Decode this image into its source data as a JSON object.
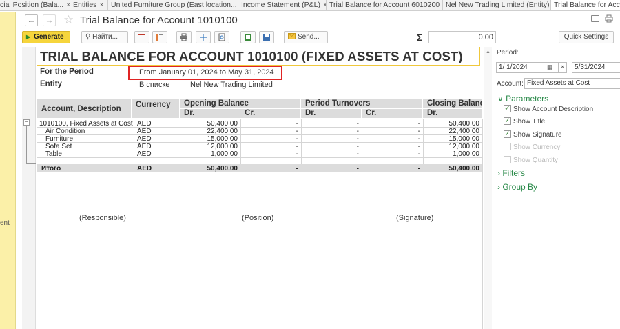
{
  "tabs": [
    {
      "label": "cial Position (Bala..."
    },
    {
      "label": "Entities"
    },
    {
      "label": "United Furniture Group (East location..."
    },
    {
      "label": "Income Statement (P&L)"
    },
    {
      "label": "Trial Balance for Account 6010200"
    },
    {
      "label": "Nel New Trading Limited (Entity)"
    },
    {
      "label": "Trial Balance for Acco"
    }
  ],
  "tab_close": "×",
  "left_strip_text": "ent",
  "nav": {
    "back": "←",
    "forward": "→",
    "star": "☆"
  },
  "window_title": "Trial Balance for Account 1010100",
  "toolbar": {
    "generate": "Generate",
    "find": "Найти...",
    "send": "Send...",
    "sigma": "Σ",
    "sum_value": "0.00",
    "quick_settings": "Quick Settings"
  },
  "report": {
    "title": "TRIAL BALANCE FOR ACCOUNT 1010100 (FIXED ASSETS AT COST)",
    "period_label": "For the Period",
    "period_value": "From January 01, 2024 to May 31, 2024",
    "entity_label": "Entity",
    "entity_filter": "В списке",
    "entity_value": "Nel New Trading Limited",
    "headers": {
      "account": "Account, Description",
      "currency": "Currency",
      "opening": "Opening Balance",
      "turnovers": "Period Turnovers",
      "closing": "Closing Balance",
      "dr": "Dr.",
      "cr": "Cr."
    },
    "rows": [
      {
        "account": "1010100, Fixed Assets at Cost",
        "currency": "AED",
        "open_dr": "50,400.00",
        "open_cr": "-",
        "turn_dr": "-",
        "turn_cr": "-",
        "close_dr": "50,400.00"
      },
      {
        "account": "Air Condition",
        "currency": "AED",
        "open_dr": "22,400.00",
        "open_cr": "-",
        "turn_dr": "-",
        "turn_cr": "-",
        "close_dr": "22,400.00"
      },
      {
        "account": "Furniture",
        "currency": "AED",
        "open_dr": "15,000.00",
        "open_cr": "-",
        "turn_dr": "-",
        "turn_cr": "-",
        "close_dr": "15,000.00"
      },
      {
        "account": "Sofa Set",
        "currency": "AED",
        "open_dr": "12,000.00",
        "open_cr": "-",
        "turn_dr": "-",
        "turn_cr": "-",
        "close_dr": "12,000.00"
      },
      {
        "account": "Table",
        "currency": "AED",
        "open_dr": "1,000.00",
        "open_cr": "-",
        "turn_dr": "-",
        "turn_cr": "-",
        "close_dr": "1,000.00"
      }
    ],
    "total": {
      "account": "Итого",
      "currency": "AED",
      "open_dr": "50,400.00",
      "open_cr": "-",
      "turn_dr": "-",
      "turn_cr": "-",
      "close_dr": "50,400.00"
    },
    "signatures": {
      "responsible": "(Responsible)",
      "position": "(Position)",
      "signature": "(Signature)"
    }
  },
  "settings": {
    "period_label": "Period:",
    "date_from": "1/ 1/2024",
    "date_to": "5/31/2024",
    "clear": "×",
    "account_label": "Account:",
    "account_value": "Fixed Assets at Cost",
    "parameters_label": "Parameters",
    "options": [
      {
        "label": "Show Account Description",
        "checked": true
      },
      {
        "label": "Show Title",
        "checked": true
      },
      {
        "label": "Show Signature",
        "checked": true
      },
      {
        "label": "Show Currency",
        "checked": false
      },
      {
        "label": "Show Quantity",
        "checked": false
      }
    ],
    "filters_label": "Filters",
    "group_by_label": "Group By"
  },
  "colors": {
    "accent_yellow": "#f6d53c",
    "highlight_red": "#e02424",
    "header_gray": "#dcdcdc",
    "group_green": "#2a8a4a"
  }
}
